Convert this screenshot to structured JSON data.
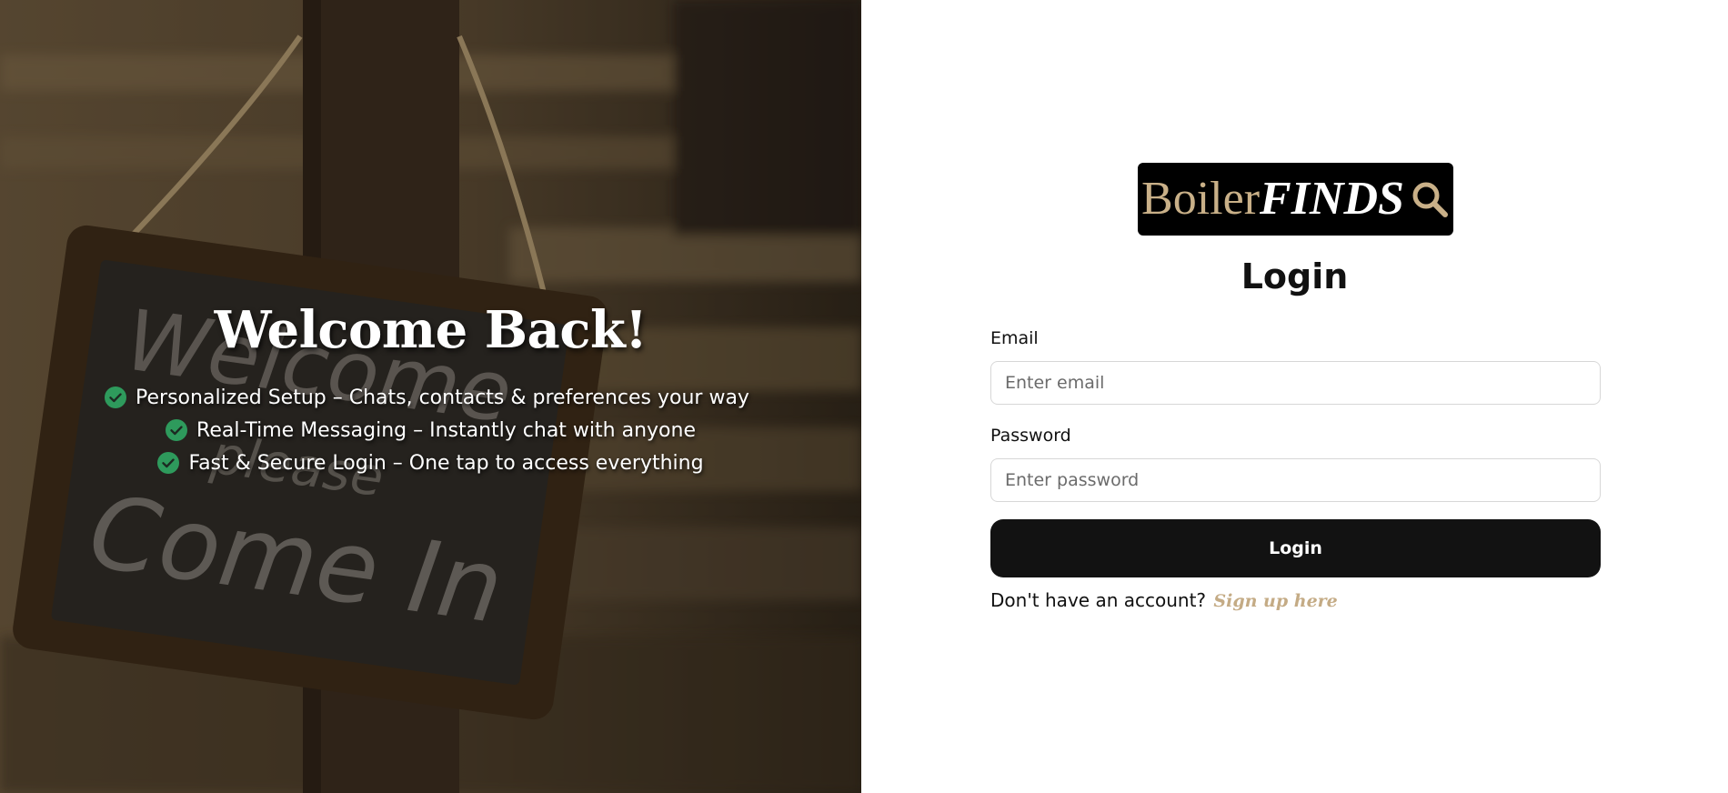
{
  "hero": {
    "title": "Welcome Back!",
    "features": [
      {
        "icon": "check-circle-icon",
        "text": "Personalized Setup – Chats, contacts & preferences your way"
      },
      {
        "icon": "check-circle-icon",
        "text": "Real-Time Messaging – Instantly chat with anyone"
      },
      {
        "icon": "check-circle-icon",
        "text": "Fast & Secure Login – One tap to access everything"
      }
    ],
    "check_color": "#2e9a5c",
    "background_sign_text": [
      "Welcome",
      "please",
      "Come In"
    ]
  },
  "logo": {
    "part1": "Boiler",
    "part2": "FINDS",
    "icon": "search-icon",
    "accent_color": "#c9b088",
    "background_color": "#000000"
  },
  "login": {
    "title": "Login",
    "email_label": "Email",
    "email_placeholder": "Enter email",
    "password_label": "Password",
    "password_placeholder": "Enter password",
    "submit_label": "Login",
    "signup_prompt": "Don't have an account?",
    "signup_link": "Sign up here",
    "link_color": "#c4ab85",
    "button_color": "#121212"
  }
}
